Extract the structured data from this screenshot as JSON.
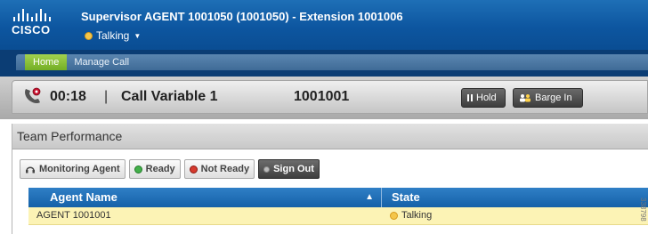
{
  "header": {
    "logo_text": "CISCO",
    "title": "Supervisor AGENT 1001050 (1001050) - Extension 1001006",
    "status_label": "Talking",
    "status_color": "#f4c64a"
  },
  "nav": {
    "tabs": [
      {
        "label": "Home",
        "active": true
      },
      {
        "label": "Manage Call",
        "active": false
      }
    ]
  },
  "call": {
    "icon": "phone-icon",
    "timer": "00:18",
    "separator": "|",
    "variable": "Call Variable 1",
    "number": "1001001",
    "hold_label": "Hold",
    "barge_label": "Barge In"
  },
  "team": {
    "panel_title": "Team Performance",
    "toolbar": {
      "monitoring_label": "Monitoring Agent",
      "ready_label": "Ready",
      "not_ready_label": "Not Ready",
      "sign_out_label": "Sign Out"
    },
    "columns": [
      "Agent Name",
      "State"
    ],
    "rows": [
      {
        "agent": "AGENT 1001001",
        "state": "Talking",
        "state_color": "#f4c64a"
      }
    ]
  },
  "watermark": "338798"
}
